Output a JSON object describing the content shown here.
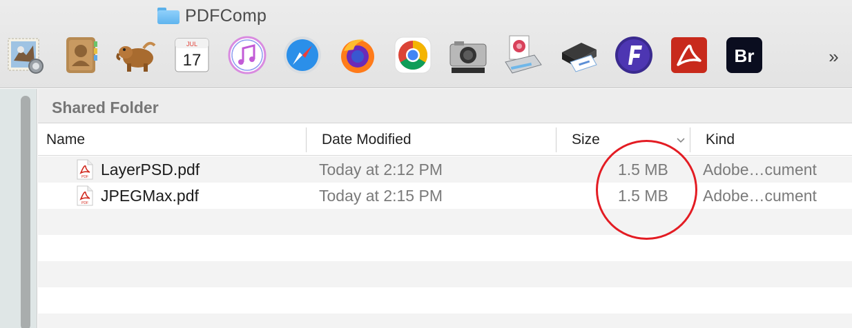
{
  "window": {
    "title": "PDFComp",
    "title_icon": "folder-icon"
  },
  "toolbar": {
    "apps": [
      {
        "name": "mail",
        "icon": "mail-stamp-eagle-icon"
      },
      {
        "name": "contacts",
        "icon": "address-book-icon"
      },
      {
        "name": "tapir",
        "icon": "tapir-app-icon"
      },
      {
        "name": "calendar",
        "icon": "calendar-icon",
        "month": "JUL",
        "day": "17"
      },
      {
        "name": "itunes",
        "icon": "music-note-icon"
      },
      {
        "name": "safari",
        "icon": "compass-icon"
      },
      {
        "name": "firefox",
        "icon": "firefox-icon"
      },
      {
        "name": "chrome",
        "icon": "chrome-icon"
      },
      {
        "name": "image-capture",
        "icon": "camera-icon"
      },
      {
        "name": "preview",
        "icon": "preview-scanner-icon"
      },
      {
        "name": "printer",
        "icon": "printer-icon"
      },
      {
        "name": "fontlab",
        "icon": "f-badge-icon",
        "letter": "F"
      },
      {
        "name": "acrobat",
        "icon": "acrobat-icon"
      },
      {
        "name": "bridge",
        "icon": "bridge-icon",
        "letters": "Br"
      }
    ],
    "overflow_label": "»"
  },
  "pane": {
    "title": "Shared Folder"
  },
  "columns": [
    {
      "key": "name",
      "label": "Name"
    },
    {
      "key": "date",
      "label": "Date Modified"
    },
    {
      "key": "size",
      "label": "Size"
    },
    {
      "key": "kind",
      "label": "Kind"
    }
  ],
  "sort": {
    "column": "size",
    "direction": "descending"
  },
  "files": [
    {
      "name": "LayerPSD.pdf",
      "date": "Today at 2:12 PM",
      "size": "1.5 MB",
      "kind": "Adobe…cument",
      "icon": "pdf-file-icon"
    },
    {
      "name": "JPEGMax.pdf",
      "date": "Today at 2:15 PM",
      "size": "1.5 MB",
      "kind": "Adobe…cument",
      "icon": "pdf-file-icon"
    }
  ],
  "colors": {
    "highlight": "#e31c23",
    "folder": "#5fb4ee",
    "acrobat": "#cc2a1c"
  }
}
